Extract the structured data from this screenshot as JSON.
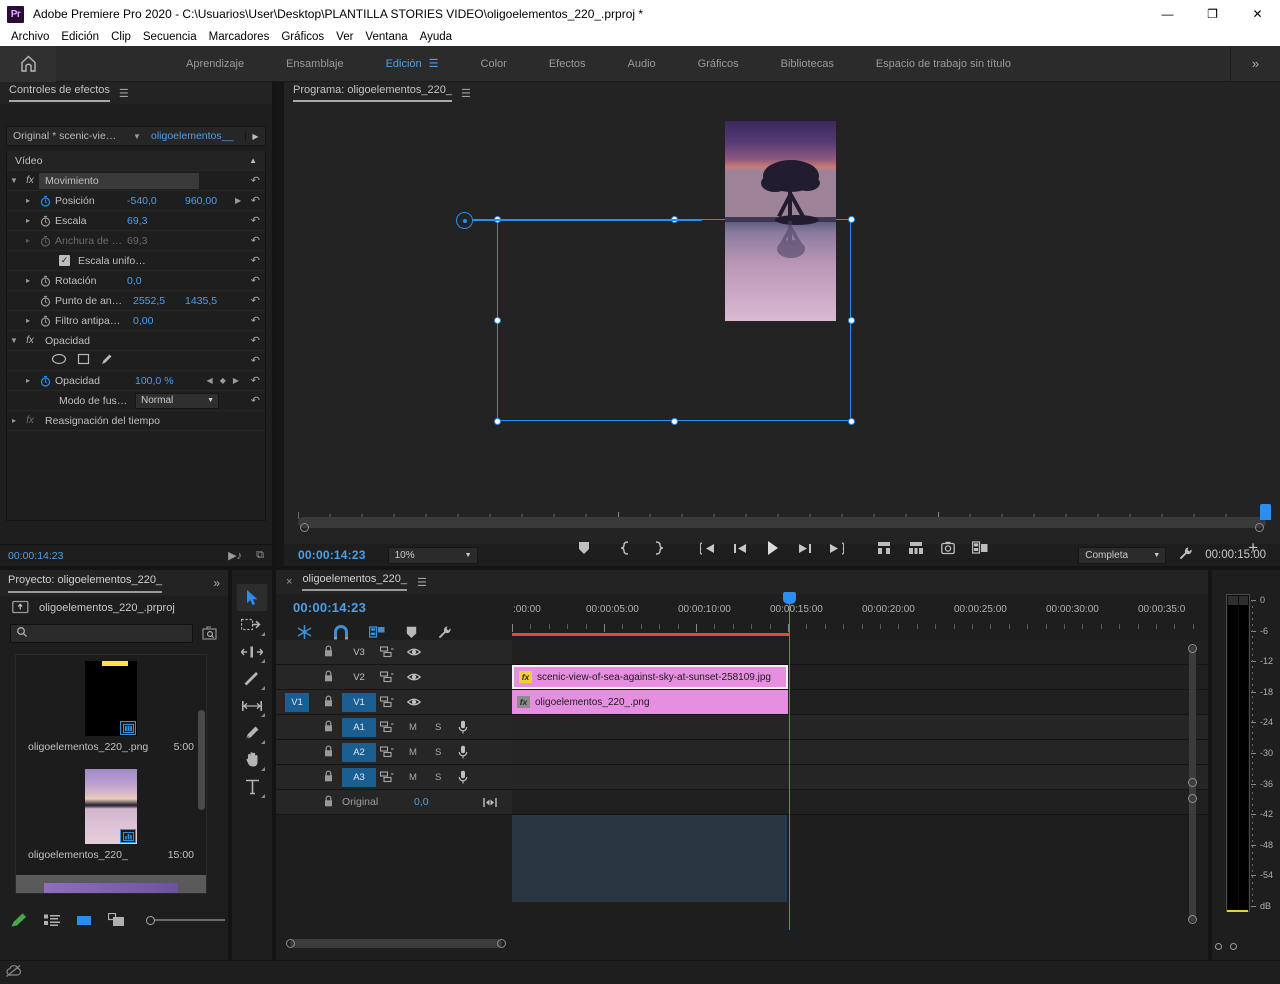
{
  "window": {
    "title": "Adobe Premiere Pro 2020 - C:\\Usuarios\\User\\Desktop\\PLANTILLA STORIES VIDEO\\oligoelementos_220_.prproj *",
    "logo": "Pr",
    "minimize": "—",
    "maximize": "❐",
    "close": "✕"
  },
  "menubar": {
    "items": [
      {
        "label": "Archivo"
      },
      {
        "label": "Edición"
      },
      {
        "label": "Clip"
      },
      {
        "label": "Secuencia"
      },
      {
        "label": "Marcadores"
      },
      {
        "label": "Gráficos"
      },
      {
        "label": "Ver"
      },
      {
        "label": "Ventana"
      },
      {
        "label": "Ayuda"
      }
    ]
  },
  "workspace": {
    "home_icon": "home-icon",
    "tabs": [
      {
        "label": "Aprendizaje",
        "active": false
      },
      {
        "label": "Ensamblaje",
        "active": false
      },
      {
        "label": "Edición",
        "active": true
      },
      {
        "label": "Color",
        "active": false
      },
      {
        "label": "Efectos",
        "active": false
      },
      {
        "label": "Audio",
        "active": false
      },
      {
        "label": "Gráficos",
        "active": false
      },
      {
        "label": "Bibliotecas",
        "active": false
      },
      {
        "label": "Espacio de trabajo sin título",
        "active": false
      }
    ],
    "more": "»"
  },
  "effect_controls": {
    "panel_title": "Controles de efectos",
    "source_clip": "Original * scenic-vie…",
    "sequence": "oligoelementos__",
    "video_group": "Vídeo",
    "rows": [
      {
        "label": "Movimiento",
        "type": "effect-header"
      },
      {
        "label": "Posición",
        "value1": "-540,0",
        "value2": "960,00",
        "type": "prop",
        "keyframed": true
      },
      {
        "label": "Escala",
        "value1": "69,3",
        "type": "prop"
      },
      {
        "label": "Anchura de …",
        "value1": "69,3",
        "type": "prop",
        "dimmed": true
      },
      {
        "label": "Escala unifo…",
        "type": "checkbox",
        "checked": true
      },
      {
        "label": "Rotación",
        "value1": "0,0",
        "type": "prop"
      },
      {
        "label": "Punto de an…",
        "value1": "2552,5",
        "value2": "1435,5",
        "type": "prop"
      },
      {
        "label": "Filtro antipa…",
        "value1": "0,00",
        "type": "prop"
      },
      {
        "label": "Opacidad",
        "type": "effect-header"
      },
      {
        "label": "",
        "type": "mask-tools"
      },
      {
        "label": "Opacidad",
        "value1": "100,0 %",
        "type": "prop",
        "keyframed": true
      },
      {
        "label": "Modo de fus…",
        "value1": "Normal",
        "type": "select"
      },
      {
        "label": "Reasignación del tiempo",
        "type": "effect-header-collapsed"
      }
    ],
    "footer_timecode": "00:00:14:23"
  },
  "program_monitor": {
    "panel_title": "Programa: oligoelementos_220_",
    "timecode": "00:00:14:23",
    "zoom_level": "10%",
    "quality": "Completa",
    "duration": "00:00:15:00",
    "transport": [
      {
        "name": "add-marker-button",
        "glyph": "marker"
      },
      {
        "name": "mark-in-button",
        "glyph": "{"
      },
      {
        "name": "mark-out-button",
        "glyph": "}"
      },
      {
        "name": "go-to-in-button",
        "glyph": "goto-in"
      },
      {
        "name": "step-back-button",
        "glyph": "step-back"
      },
      {
        "name": "play-stop-button",
        "glyph": "play"
      },
      {
        "name": "step-forward-button",
        "glyph": "step-forward"
      },
      {
        "name": "go-to-out-button",
        "glyph": "goto-out"
      },
      {
        "name": "lift-button",
        "glyph": "lift"
      },
      {
        "name": "extract-button",
        "glyph": "extract"
      },
      {
        "name": "export-frame-button",
        "glyph": "camera"
      },
      {
        "name": "comparison-view-button",
        "glyph": "compare"
      }
    ],
    "button_editor": "+"
  },
  "project_panel": {
    "panel_title": "Proyecto: oligoelementos_220_",
    "more": "»",
    "project_file": "oligoelementos_220_.prproj",
    "search_placeholder": "",
    "items": [
      {
        "name": "oligoelementos_220_.png",
        "duration": "5:00",
        "kind": "png-graphic"
      },
      {
        "name": "oligoelementos_220_",
        "duration": "15:00",
        "kind": "sequence"
      }
    ],
    "tools": [
      {
        "name": "new-item-pen",
        "glyph": "pen"
      },
      {
        "name": "list-view",
        "glyph": "list"
      },
      {
        "name": "icon-view",
        "glyph": "icon"
      },
      {
        "name": "freeform-view",
        "glyph": "freeform"
      },
      {
        "name": "zoom-slider",
        "glyph": "slider"
      }
    ]
  },
  "tools_panel": {
    "tools": [
      {
        "name": "selection-tool",
        "label": "Selección",
        "active": true
      },
      {
        "name": "track-select-forward-tool",
        "label": "Seleccionar pista hacia delante",
        "active": false
      },
      {
        "name": "ripple-edit-tool",
        "label": "Editar rizo",
        "active": false
      },
      {
        "name": "razor-tool",
        "label": "Cuchilla",
        "active": false
      },
      {
        "name": "slip-tool",
        "label": "Deslizar",
        "active": false
      },
      {
        "name": "pen-tool",
        "label": "Pluma",
        "active": false
      },
      {
        "name": "hand-tool",
        "label": "Mano",
        "active": false
      },
      {
        "name": "type-tool",
        "label": "Texto",
        "active": false
      }
    ]
  },
  "timeline": {
    "close": "×",
    "sequence_name": "oligoelementos_220_",
    "timecode": "00:00:14:23",
    "tools": [
      {
        "name": "nest-sequence-toggle",
        "glyph": "nest",
        "blue": true
      },
      {
        "name": "snap-toggle",
        "glyph": "magnet",
        "blue": true
      },
      {
        "name": "linked-selection-toggle",
        "glyph": "link",
        "blue": true
      },
      {
        "name": "add-marker-button",
        "glyph": "marker",
        "blue": false
      },
      {
        "name": "timeline-display-settings",
        "glyph": "wrench",
        "blue": false
      }
    ],
    "ruler_labels": [
      ":00:00",
      "00:00:05:00",
      "00:00:10:00",
      "00:00:15:00",
      "00:00:20:00",
      "00:00:25:00",
      "00:00:30:00",
      "00:00:35:0"
    ],
    "playhead_label": "00:00:15:00",
    "tracks": [
      {
        "name": "V3",
        "kind": "video",
        "targeted": false,
        "selected": false,
        "clips": []
      },
      {
        "name": "V2",
        "kind": "video",
        "targeted": false,
        "selected": false,
        "clips": [
          {
            "label": "scenic-view-of-sea-against-sky-at-sunset-258109.jpg",
            "fx_badge": "fx",
            "badge_color": "yellow",
            "selected": true
          }
        ]
      },
      {
        "name": "V1",
        "kind": "video",
        "targeted": true,
        "selected": true,
        "clips": [
          {
            "label": "oligoelementos_220_.png",
            "fx_badge": "fx",
            "badge_color": "gray",
            "selected": false
          }
        ]
      },
      {
        "name": "A1",
        "kind": "audio",
        "targeted": false,
        "selected": true,
        "mute": "M",
        "solo": "S",
        "clips": []
      },
      {
        "name": "A2",
        "kind": "audio",
        "targeted": false,
        "selected": true,
        "mute": "M",
        "solo": "S",
        "clips": []
      },
      {
        "name": "A3",
        "kind": "audio",
        "targeted": false,
        "selected": true,
        "mute": "M",
        "solo": "S",
        "clips": []
      },
      {
        "name": "Original",
        "kind": "master",
        "value": "0,0",
        "clips": []
      }
    ]
  },
  "audio_meters": {
    "scale_labels": [
      "0",
      "-6",
      "-12",
      "-18",
      "-24",
      "-30",
      "-36",
      "-42",
      "-48",
      "-54",
      "dB"
    ]
  },
  "statusbar": {
    "cc_icon": "creative-cloud-icon"
  },
  "colors": {
    "accent_blue": "#2c8df0",
    "text_blue": "#4d9fe8",
    "clip_pink": "#e68fe0",
    "track_target_blue": "#1b5e91",
    "workarea_red": "#e8473f",
    "meter_yellow": "#e3d23a",
    "panel_bg": "#1e1e1e"
  }
}
